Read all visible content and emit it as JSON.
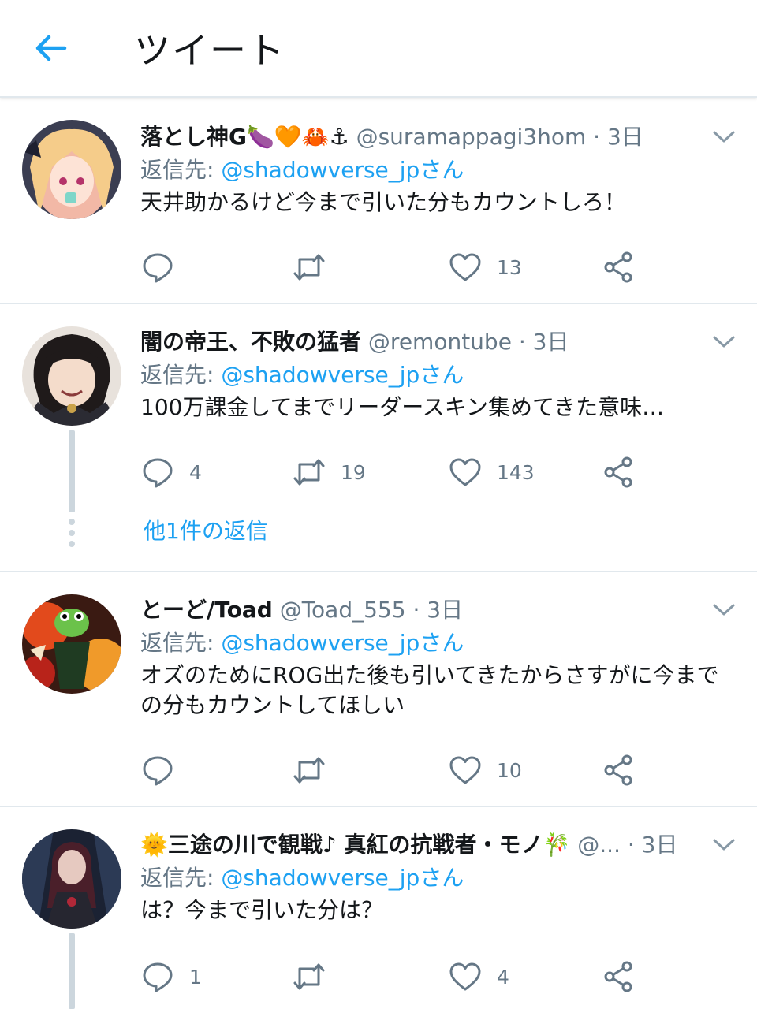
{
  "header": {
    "title": "ツイート",
    "back_icon": "arrow-left-icon"
  },
  "colors": {
    "accent": "#1da1f2",
    "muted": "#657786",
    "border": "#e1e8ed"
  },
  "tweets": [
    {
      "name": "落とし神G🍆🧡🦀⚓",
      "handle": "@suramappagi3hom",
      "sep": " · ",
      "time": "3日",
      "reply_prefix": "返信先: ",
      "reply_to": "@shadowverse_jpさん",
      "text": "天井助かるけど今まで引いた分もカウントしろ！",
      "replies": "",
      "retweets": "",
      "likes": "13"
    },
    {
      "name": "闇の帝王、不敗の猛者",
      "handle": "@remontube",
      "sep": " · ",
      "time": "3日",
      "reply_prefix": "返信先: ",
      "reply_to": "@shadowverse_jpさん",
      "text": "100万課金してまでリーダースキン集めてきた意味…",
      "replies": "4",
      "retweets": "19",
      "likes": "143",
      "more_replies": "他1件の返信"
    },
    {
      "name": "とーど/Toad",
      "handle": "@Toad_555",
      "sep": " · ",
      "time": "3日",
      "reply_prefix": "返信先: ",
      "reply_to": "@shadowverse_jpさん",
      "text": "オズのためにROG出た後も引いてきたからさすがに今までの分もカウントしてほしい",
      "replies": "",
      "retweets": "",
      "likes": "10"
    },
    {
      "name": "🌞三途の川で観戦♪ 真紅の抗戦者・モノ🎋",
      "handle": "@...",
      "sep": " · ",
      "time": "3日",
      "reply_prefix": "返信先: ",
      "reply_to": "@shadowverse_jpさん",
      "text": "は？今まで引いた分は？",
      "replies": "1",
      "retweets": "",
      "likes": "4"
    }
  ]
}
